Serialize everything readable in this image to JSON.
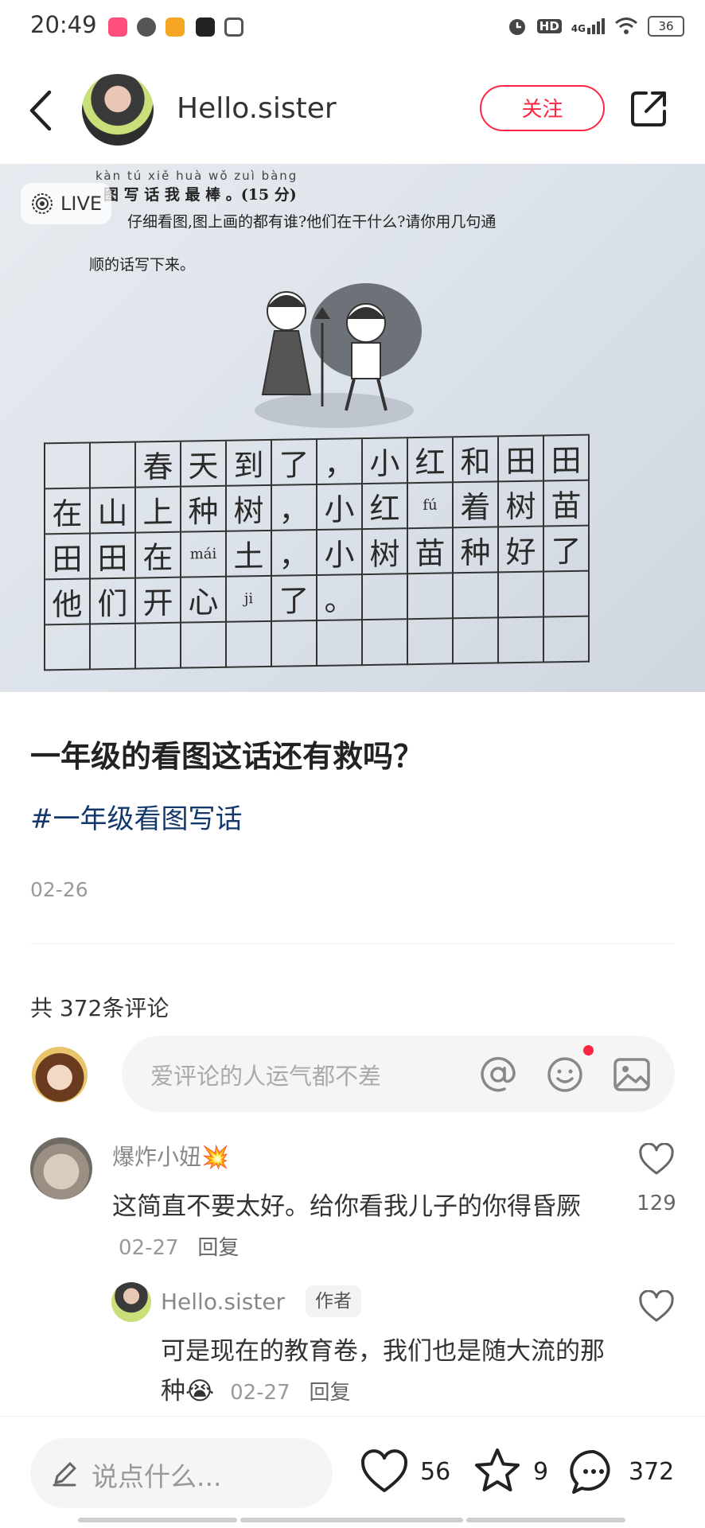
{
  "status_bar": {
    "time": "20:49",
    "network": "4G",
    "hd": "HD",
    "battery": "36"
  },
  "header": {
    "author_name": "Hello.sister",
    "follow_label": "关注"
  },
  "photo": {
    "live_label": "LIVE",
    "pinyin": "kàn tú xiě huà wǒ zuì bàng",
    "question_title": "图 写 话 我 最 棒 。(15 分)",
    "question_line1": "仔细看图,图上画的都有谁?他们在干什么?请你用几句通",
    "question_line2": "顺的话写下来。",
    "grid_rows": [
      [
        "",
        "",
        "春",
        "天",
        "到",
        "了",
        "，",
        "小",
        "红",
        "和",
        "田",
        "田"
      ],
      [
        "在",
        "山",
        "上",
        "种",
        "树",
        "，",
        "小",
        "红",
        "fú",
        "着",
        "树",
        "苗"
      ],
      [
        "田",
        "田",
        "在",
        "mái",
        "土",
        "，",
        "小",
        "树",
        "苗",
        "种",
        "好",
        "了"
      ],
      [
        "他",
        "们",
        "开",
        "心",
        "ji",
        "了",
        "。",
        "",
        "",
        "",
        "",
        ""
      ],
      [
        "",
        "",
        "",
        "",
        "",
        "",
        "",
        "",
        "",
        "",
        "",
        ""
      ]
    ]
  },
  "post": {
    "title": "一年级的看图这话还有救吗？",
    "tag": "#一年级看图写话",
    "date": "02-26"
  },
  "comments_section": {
    "count_label": "共 372条评论",
    "input_placeholder": "爱评论的人运气都不差"
  },
  "comments": [
    {
      "name": "爆炸小妞💥",
      "text": "这简直不要太好。给你看我儿子的你得昏厥",
      "date": "02-27",
      "reply_label": "回复",
      "likes": "129"
    }
  ],
  "reply": {
    "name": "Hello.sister",
    "badge": "作者",
    "text": "可是现在的教育卷，我们也是随大流的那种😭",
    "date": "02-27",
    "reply_label": "回复"
  },
  "bottom_bar": {
    "say_placeholder": "说点什么...",
    "likes": "56",
    "stars": "9",
    "comments": "372"
  },
  "colors": {
    "accent": "#ff2442",
    "tag": "#13386c"
  }
}
